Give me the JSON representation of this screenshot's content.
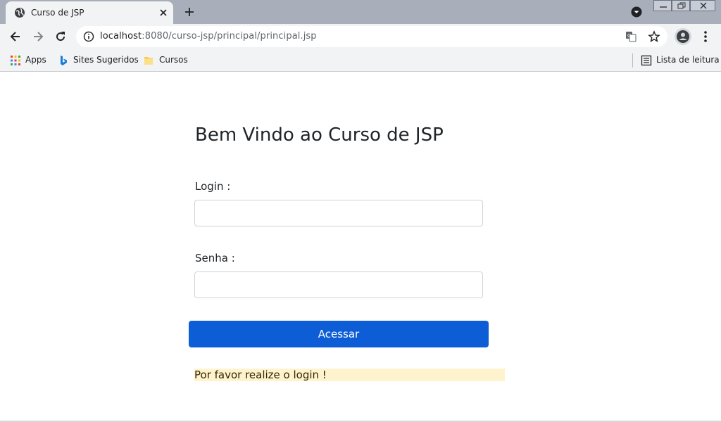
{
  "browser": {
    "tab_title": "Curso de JSP",
    "url_host": "localhost",
    "url_rest": ":8080/curso-jsp/principal/principal.jsp",
    "bookmarks": [
      {
        "label": "Apps",
        "icon": "apps-grid-icon"
      },
      {
        "label": "Sites Sugeridos",
        "icon": "bing-icon"
      },
      {
        "label": "Cursos",
        "icon": "folder-icon"
      }
    ],
    "reading_list_label": "Lista de leitura"
  },
  "page": {
    "title": "Bem Vindo ao Curso de JSP",
    "login_label": "Login :",
    "login_value": "",
    "password_label": "Senha :",
    "password_value": "",
    "submit_label": "Acessar",
    "message": "Por favor realize o login !"
  },
  "colors": {
    "primary": "#0d5dd6",
    "alert_bg": "#fff3cd",
    "tabstrip_bg": "#a8aeba"
  }
}
